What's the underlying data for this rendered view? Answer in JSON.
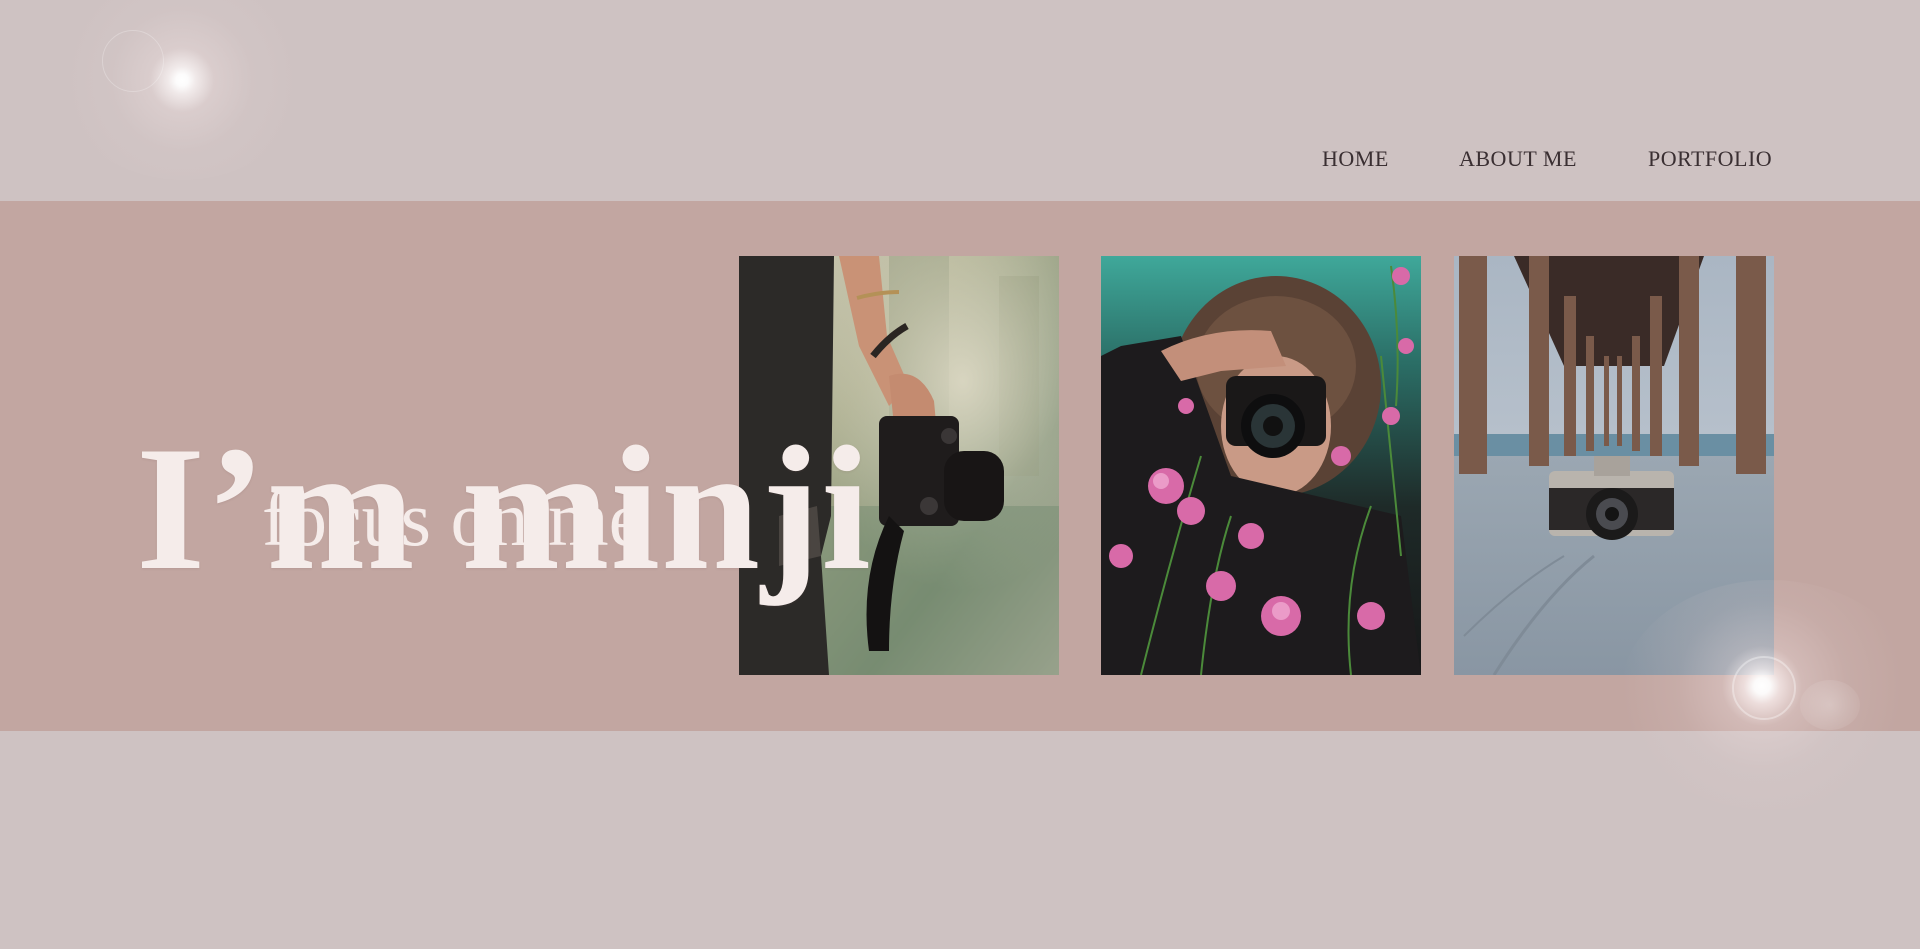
{
  "nav": {
    "items": [
      {
        "label": "HOME"
      },
      {
        "label": "ABOUT ME"
      },
      {
        "label": "PORTFOLIO"
      }
    ]
  },
  "hero": {
    "title": "I’m minji",
    "subtitle": "focus on me"
  },
  "gallery": {
    "photos": [
      {
        "subject": "hand holding camera by lake"
      },
      {
        "subject": "person photographing through pink flowers"
      },
      {
        "subject": "vintage camera on sand under pier"
      }
    ]
  },
  "colors": {
    "background": "#cec2c2",
    "band": "#c2a6a1",
    "hero_text": "#f5ecea",
    "nav_text": "#3a2f32"
  }
}
